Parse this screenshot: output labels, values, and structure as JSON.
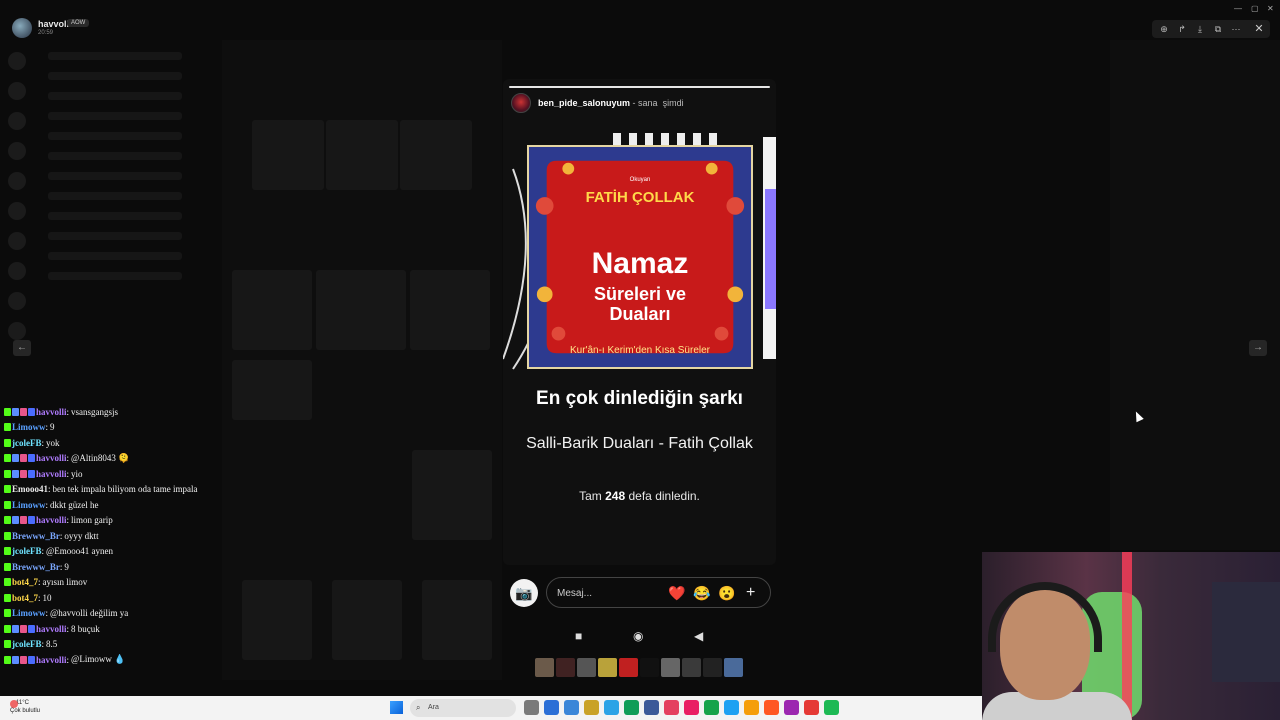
{
  "window": {
    "title": ""
  },
  "profile": {
    "username": "havvolli",
    "badge": "AOW",
    "time": "20:59"
  },
  "story": {
    "author": "ben_pide_salonuyum",
    "audience": "sana",
    "posted": "şimdi",
    "artwork": {
      "okuyan": "Okuyan",
      "artist": "FATİH ÇOLLAK",
      "title_line1": "Namaz",
      "title_line2": "Süreleri ve",
      "title_line3": "Duaları",
      "subtitle": "Kur'ân-ı Kerim'den Kısa Süreler"
    },
    "headline": "En çok dinlediğin şarkı",
    "song": "Salli-Barik Duaları - Fatih Çollak",
    "count_prefix": "Tam",
    "count_value": "248",
    "count_suffix": "defa dinledin."
  },
  "reply": {
    "placeholder": "Mesaj...",
    "reactions": [
      "❤️",
      "😂",
      "😮"
    ],
    "plus": "+",
    "camera": "📷"
  },
  "android_nav": {
    "recent": "■",
    "home": "◉",
    "back": "◀"
  },
  "chat": [
    {
      "user": "havvolli",
      "color": "#b07cff",
      "badges": [
        "k",
        "sw",
        "h",
        "r"
      ],
      "text": "vsansgangsjs"
    },
    {
      "user": "Limoww",
      "color": "#5aa0ff",
      "badges": [
        "k"
      ],
      "text": "9"
    },
    {
      "user": "jcoleFB",
      "color": "#6fe3ff",
      "badges": [
        "k"
      ],
      "text": "yok"
    },
    {
      "user": "havvolli",
      "color": "#b07cff",
      "badges": [
        "k",
        "sw",
        "h",
        "r"
      ],
      "text": "@Altin8043 🫠"
    },
    {
      "user": "havvolli",
      "color": "#b07cff",
      "badges": [
        "k",
        "sw",
        "h",
        "r"
      ],
      "text": "yio"
    },
    {
      "user": "Emooo41",
      "color": "#e9e9e9",
      "badges": [
        "k"
      ],
      "text": "ben tek impala biliyom oda tame impala"
    },
    {
      "user": "Limoww",
      "color": "#5aa0ff",
      "badges": [
        "k"
      ],
      "text": "dkkt güzel he"
    },
    {
      "user": "havvolli",
      "color": "#b07cff",
      "badges": [
        "k",
        "sw",
        "h",
        "r"
      ],
      "text": "limon garip"
    },
    {
      "user": "Brewww_Br",
      "color": "#7aa7ff",
      "badges": [
        "k"
      ],
      "text": "oyyy dktt"
    },
    {
      "user": "jcoleFB",
      "color": "#6fe3ff",
      "badges": [
        "k"
      ],
      "text": "@Emooo41 aynen"
    },
    {
      "user": "Brewww_Br",
      "color": "#7aa7ff",
      "badges": [
        "k"
      ],
      "text": "9"
    },
    {
      "user": "bot4_7",
      "color": "#ffd84a",
      "badges": [
        "k"
      ],
      "text": "ayısın limov"
    },
    {
      "user": "bot4_7",
      "color": "#ffd84a",
      "badges": [
        "k"
      ],
      "text": "10"
    },
    {
      "user": "Limoww",
      "color": "#5aa0ff",
      "badges": [
        "k"
      ],
      "text": "@havvolli değilim ya"
    },
    {
      "user": "havvolli",
      "color": "#b07cff",
      "badges": [
        "k",
        "sw",
        "h",
        "r"
      ],
      "text": "8 buçuk"
    },
    {
      "user": "jcoleFB",
      "color": "#6fe3ff",
      "badges": [
        "k"
      ],
      "text": "8.5"
    },
    {
      "user": "havvolli",
      "color": "#b07cff",
      "badges": [
        "k",
        "sw",
        "h",
        "r"
      ],
      "text": "@Limoww 💧"
    }
  ],
  "taskbar": {
    "weather_temp": "11°C",
    "weather_desc": "Çok bulutlu",
    "search_placeholder": "Ara",
    "icons": [
      "#7a7a7a",
      "#2b6fd6",
      "#3a86d8",
      "#c9a227",
      "#2ba3e6",
      "#0f9d58",
      "#3b5998",
      "#e4405f",
      "#e91e63",
      "#16a34a",
      "#1da1f2",
      "#f59e0b",
      "#ff5722",
      "#9c27b0",
      "#e53935",
      "#1db954"
    ]
  },
  "viewer_tools": [
    "zoom-in-icon",
    "share-icon",
    "download-icon",
    "open-external-icon",
    "more-icon"
  ]
}
